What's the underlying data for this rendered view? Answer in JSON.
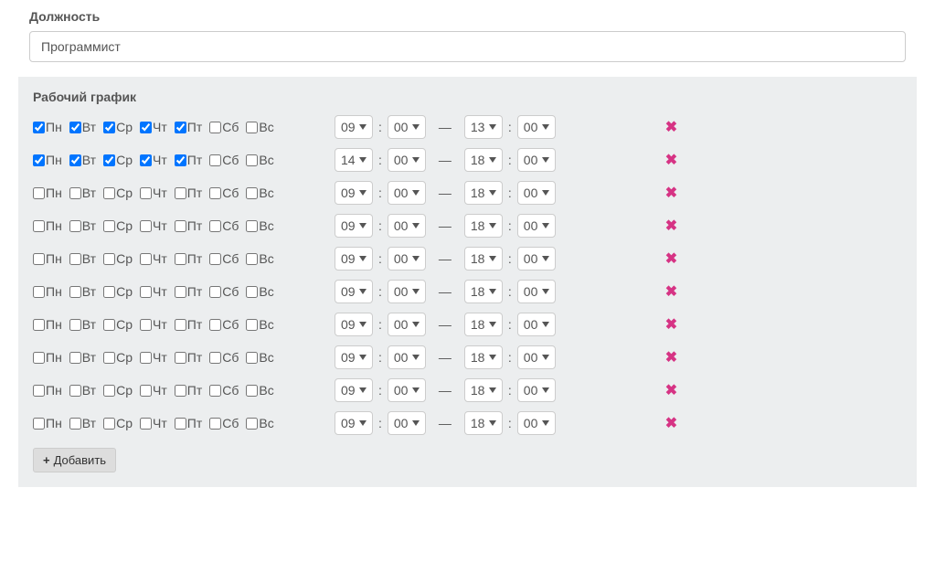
{
  "position": {
    "label": "Должность",
    "value": "Программист"
  },
  "schedule": {
    "title": "Рабочий график",
    "days": [
      "Пн",
      "Вт",
      "Ср",
      "Чт",
      "Пт",
      "Сб",
      "Вс"
    ],
    "dash": "—",
    "colon": ":",
    "addLabel": "Добавить",
    "rows": [
      {
        "checked": [
          true,
          true,
          true,
          true,
          true,
          false,
          false
        ],
        "startH": "09",
        "startM": "00",
        "endH": "13",
        "endM": "00"
      },
      {
        "checked": [
          true,
          true,
          true,
          true,
          true,
          false,
          false
        ],
        "startH": "14",
        "startM": "00",
        "endH": "18",
        "endM": "00"
      },
      {
        "checked": [
          false,
          false,
          false,
          false,
          false,
          false,
          false
        ],
        "startH": "09",
        "startM": "00",
        "endH": "18",
        "endM": "00"
      },
      {
        "checked": [
          false,
          false,
          false,
          false,
          false,
          false,
          false
        ],
        "startH": "09",
        "startM": "00",
        "endH": "18",
        "endM": "00"
      },
      {
        "checked": [
          false,
          false,
          false,
          false,
          false,
          false,
          false
        ],
        "startH": "09",
        "startM": "00",
        "endH": "18",
        "endM": "00"
      },
      {
        "checked": [
          false,
          false,
          false,
          false,
          false,
          false,
          false
        ],
        "startH": "09",
        "startM": "00",
        "endH": "18",
        "endM": "00"
      },
      {
        "checked": [
          false,
          false,
          false,
          false,
          false,
          false,
          false
        ],
        "startH": "09",
        "startM": "00",
        "endH": "18",
        "endM": "00"
      },
      {
        "checked": [
          false,
          false,
          false,
          false,
          false,
          false,
          false
        ],
        "startH": "09",
        "startM": "00",
        "endH": "18",
        "endM": "00"
      },
      {
        "checked": [
          false,
          false,
          false,
          false,
          false,
          false,
          false
        ],
        "startH": "09",
        "startM": "00",
        "endH": "18",
        "endM": "00"
      },
      {
        "checked": [
          false,
          false,
          false,
          false,
          false,
          false,
          false
        ],
        "startH": "09",
        "startM": "00",
        "endH": "18",
        "endM": "00"
      }
    ]
  }
}
